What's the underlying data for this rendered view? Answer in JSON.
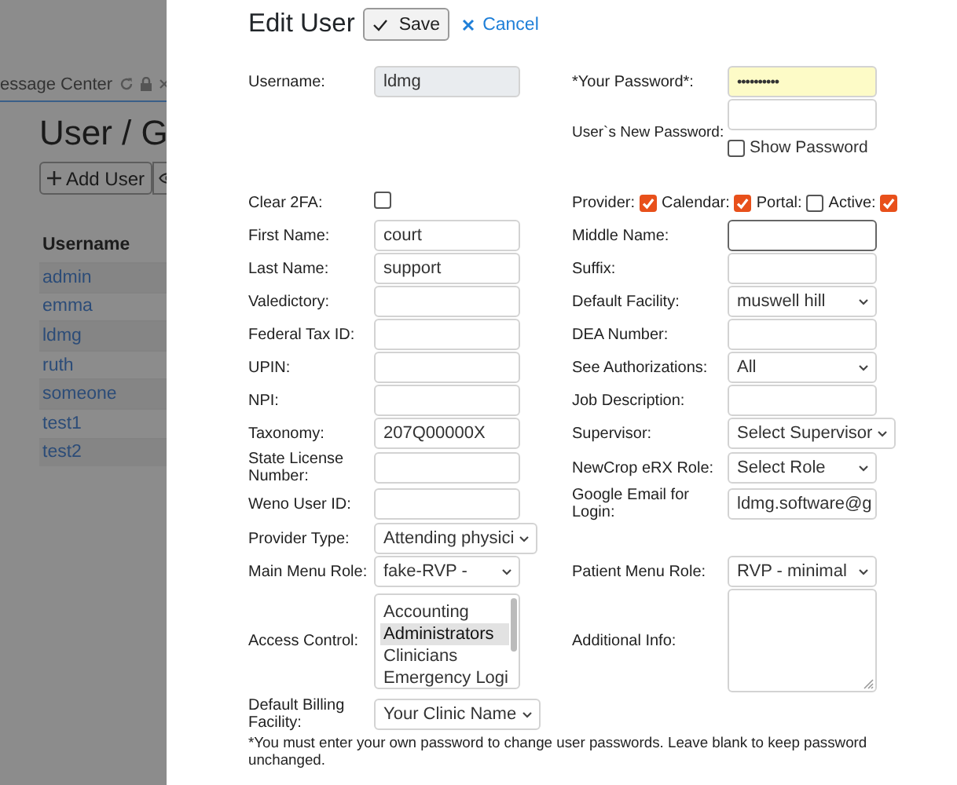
{
  "background_page": {
    "tab": {
      "label": "essage Center"
    },
    "heading": "User / G",
    "toolbar": [
      {
        "kind": "add",
        "label": "Add User"
      },
      {
        "kind": "view"
      }
    ],
    "table": {
      "columns": [
        "Username"
      ],
      "rows": [
        [
          "admin"
        ],
        [
          "emma"
        ],
        [
          "ldmg"
        ],
        [
          "ruth"
        ],
        [
          "someone"
        ],
        [
          "test1"
        ],
        [
          "test2"
        ]
      ]
    }
  },
  "dialog": {
    "title": "Edit User",
    "buttons": [
      {
        "kind": "save",
        "label": "Save"
      },
      {
        "kind": "cancel",
        "label": "Cancel"
      }
    ],
    "rows": [
      {
        "left": {
          "label": "Username:",
          "kind": "readonly",
          "value": "ldmg"
        },
        "right": {
          "label": "*Your Password*:",
          "kind": "password",
          "value": "••••••••••"
        }
      },
      {
        "right": {
          "label": "User`s New Password:",
          "kind": "new_password",
          "show_label": "Show Password",
          "show_checked": false
        }
      },
      {
        "left": {
          "label": "Clear 2FA:",
          "kind": "checkbox",
          "checked": false
        },
        "right": {
          "kind": "flags",
          "flags": [
            {
              "label": "Provider:",
              "checked": true
            },
            {
              "label": "Calendar:",
              "checked": true
            },
            {
              "label": "Portal:",
              "checked": false
            },
            {
              "label": "Active:",
              "checked": true
            }
          ]
        }
      },
      {
        "left": {
          "label": "First Name:",
          "kind": "text",
          "value": "court"
        },
        "right": {
          "label": "Middle Name:",
          "kind": "text",
          "focused": true
        }
      },
      {
        "left": {
          "label": "Last Name:",
          "kind": "text",
          "value": "support"
        },
        "right": {
          "label": "Suffix:",
          "kind": "text"
        }
      },
      {
        "left": {
          "label": "Valedictory:",
          "kind": "text"
        },
        "right": {
          "label": "Default Facility:",
          "kind": "select",
          "value": "muswell hill"
        }
      },
      {
        "left": {
          "label": "Federal Tax ID:",
          "kind": "text"
        },
        "right": {
          "label": "DEA Number:",
          "kind": "text"
        }
      },
      {
        "left": {
          "label": "UPIN:",
          "kind": "text"
        },
        "right": {
          "label": "See Authorizations:",
          "kind": "select",
          "value": "All"
        }
      },
      {
        "left": {
          "label": "NPI:",
          "kind": "text"
        },
        "right": {
          "label": "Job Description:",
          "kind": "text"
        }
      },
      {
        "left": {
          "label": "Taxonomy:",
          "kind": "text",
          "value": "207Q00000X"
        },
        "right": {
          "label": "Supervisor:",
          "kind": "select",
          "value": "Select Supervisor"
        }
      },
      {
        "left": {
          "label": "State License Number:",
          "kind": "text"
        },
        "right": {
          "label": "NewCrop eRX Role:",
          "kind": "select",
          "value": "Select Role"
        }
      },
      {
        "left": {
          "label": "Weno User ID:",
          "kind": "text"
        },
        "right": {
          "label": "Google Email for Login:",
          "kind": "text",
          "value": "ldmg.software@g"
        }
      },
      {
        "left": {
          "label": "Provider Type:",
          "kind": "select",
          "value": "Attending physici"
        }
      },
      {
        "left": {
          "label": "Main Menu Role:",
          "kind": "select",
          "value": "fake-RVP -"
        },
        "right": {
          "label": "Patient Menu Role:",
          "kind": "select",
          "value": "RVP - minimal"
        }
      },
      {
        "left": {
          "label": "Access Control:",
          "kind": "listbox",
          "options": [
            {
              "label": "Accounting",
              "selected": false
            },
            {
              "label": "Administrators",
              "selected": true
            },
            {
              "label": "Clinicians",
              "selected": false
            },
            {
              "label": "Emergency Logi",
              "selected": false
            }
          ]
        },
        "right": {
          "label": "Additional Info:",
          "kind": "textarea"
        }
      },
      {
        "left": {
          "label": "Default Billing Facility:",
          "kind": "select",
          "value": "Your Clinic Name"
        }
      }
    ],
    "note": "*You must enter your own password to change user passwords. Leave blank to keep password unchanged."
  }
}
